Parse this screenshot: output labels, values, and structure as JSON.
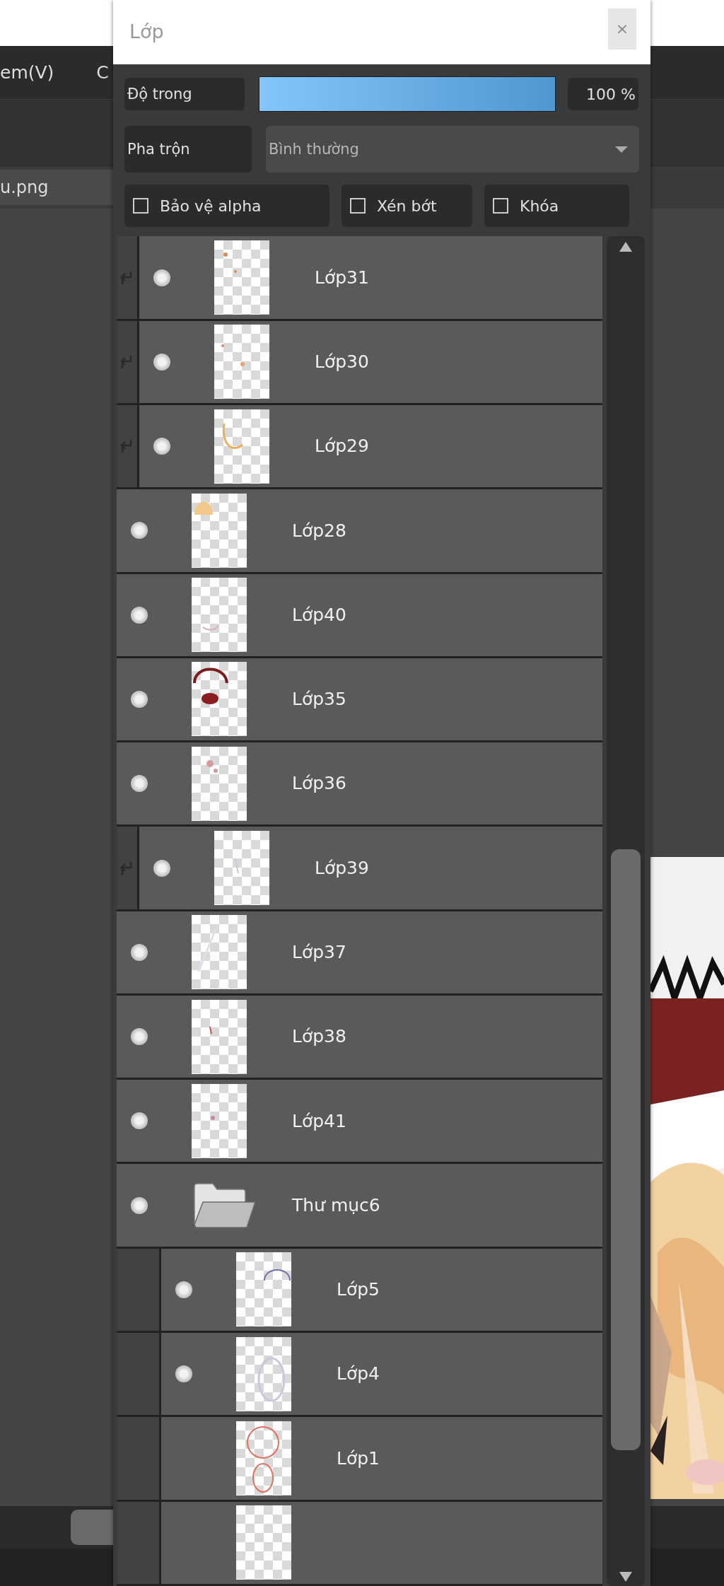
{
  "app": {
    "menu": [
      "em(V)",
      "C"
    ],
    "tab": "u.png",
    "canvas": {
      "kind": "picture"
    }
  },
  "panel": {
    "title": "Lớp",
    "close": "×",
    "opacity": {
      "label": "Độ trong",
      "level": 1,
      "reading": "100 %"
    },
    "blend": {
      "label": "Pha trộn",
      "value": "Bình thường"
    },
    "options": [
      {
        "label": "Bảo vệ alpha",
        "checked": false
      },
      {
        "label": "Xén bớt",
        "checked": false
      },
      {
        "label": "Khóa",
        "checked": false
      }
    ],
    "layers": [
      {
        "kind": "layer",
        "name": "Lớp31",
        "visible": true,
        "clipping": true
      },
      {
        "kind": "layer",
        "name": "Lớp30",
        "visible": true,
        "clipping": true
      },
      {
        "kind": "layer",
        "name": "Lớp29",
        "visible": true,
        "clipping": true
      },
      {
        "kind": "layer",
        "name": "Lớp28",
        "visible": true,
        "clipping": false
      },
      {
        "kind": "layer",
        "name": "Lớp40",
        "visible": true,
        "clipping": false
      },
      {
        "kind": "layer",
        "name": "Lớp35",
        "visible": true,
        "clipping": false
      },
      {
        "kind": "layer",
        "name": "Lớp36",
        "visible": true,
        "clipping": false
      },
      {
        "kind": "layer",
        "name": "Lớp39",
        "visible": true,
        "clipping": true
      },
      {
        "kind": "layer",
        "name": "Lớp37",
        "visible": true,
        "clipping": false
      },
      {
        "kind": "layer",
        "name": "Lớp38",
        "visible": true,
        "clipping": false
      },
      {
        "kind": "layer",
        "name": "Lớp41",
        "visible": true,
        "clipping": false
      },
      {
        "kind": "folder",
        "name": "Thư mục6",
        "visible": true,
        "children": [
          {
            "kind": "layer",
            "name": "Lớp5",
            "visible": true,
            "clipping": false
          },
          {
            "kind": "layer",
            "name": "Lớp4",
            "visible": true,
            "clipping": false
          },
          {
            "kind": "layer",
            "name": "Lớp1",
            "visible": false,
            "clipping": false
          },
          {
            "kind": "layer"
          }
        ]
      }
    ]
  }
}
